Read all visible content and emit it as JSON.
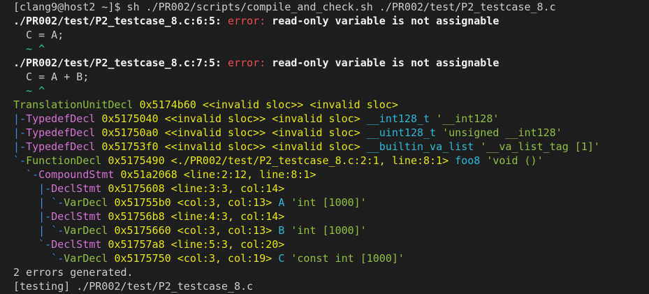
{
  "window": {
    "title": ""
  },
  "colors": {
    "background": "#1e1e1e",
    "default": "#cccccc",
    "bold_white": "#f2f2f2",
    "error_red": "#f14c4c",
    "caret_green": "#23d18b",
    "node_green": "#8ec03f",
    "addr_yellow": "#e5e510",
    "tree_blue": "#3b8eea",
    "node_magenta": "#d670d6",
    "ident_cyan": "#29b8db",
    "quote_green": "#8ec03f"
  },
  "terminal": {
    "lines": [
      {
        "segments": [
          {
            "text": "[clang9@host2 ~]$ sh ./PR002/scripts/compile_and_check.sh ./PR002/test/P2_testcase_8.c",
            "color": "#cccccc",
            "bold": false
          }
        ]
      },
      {
        "segments": [
          {
            "text": "./PR002/test/P2_testcase_8.c:6:5: ",
            "color": "#f2f2f2",
            "bold": true
          },
          {
            "text": "error: ",
            "color": "#f14c4c",
            "bold": false
          },
          {
            "text": "read-only variable is not assignable",
            "color": "#f2f2f2",
            "bold": true
          }
        ]
      },
      {
        "segments": [
          {
            "text": "  C = A;",
            "color": "#cccccc",
            "bold": false
          }
        ]
      },
      {
        "segments": [
          {
            "text": "  ~ ^",
            "color": "#23d18b",
            "bold": false
          }
        ]
      },
      {
        "segments": [
          {
            "text": "./PR002/test/P2_testcase_8.c:7:5: ",
            "color": "#f2f2f2",
            "bold": true
          },
          {
            "text": "error: ",
            "color": "#f14c4c",
            "bold": false
          },
          {
            "text": "read-only variable is not assignable",
            "color": "#f2f2f2",
            "bold": true
          }
        ]
      },
      {
        "segments": [
          {
            "text": "  C = A + B;",
            "color": "#cccccc",
            "bold": false
          }
        ]
      },
      {
        "segments": [
          {
            "text": "  ~ ^",
            "color": "#23d18b",
            "bold": false
          }
        ]
      },
      {
        "segments": [
          {
            "text": "TranslationUnitDecl ",
            "color": "#8ec03f",
            "bold": false
          },
          {
            "text": "0x5174b60",
            "color": "#e5e510",
            "bold": false
          },
          {
            "text": " <<invalid sloc>> ",
            "color": "#e5e510",
            "bold": false
          },
          {
            "text": "<invalid sloc>",
            "color": "#e5e510",
            "bold": false
          }
        ]
      },
      {
        "segments": [
          {
            "text": "|-",
            "color": "#3b8eea",
            "bold": false
          },
          {
            "text": "TypedefDecl ",
            "color": "#d670d6",
            "bold": false
          },
          {
            "text": "0x5175040",
            "color": "#e5e510",
            "bold": false
          },
          {
            "text": " <<invalid sloc>> ",
            "color": "#e5e510",
            "bold": false
          },
          {
            "text": "<invalid sloc>",
            "color": "#e5e510",
            "bold": false
          },
          {
            "text": " __int128_t ",
            "color": "#29b8db",
            "bold": false
          },
          {
            "text": "'__int128'",
            "color": "#8ec03f",
            "bold": false
          }
        ]
      },
      {
        "segments": [
          {
            "text": "|-",
            "color": "#3b8eea",
            "bold": false
          },
          {
            "text": "TypedefDecl ",
            "color": "#d670d6",
            "bold": false
          },
          {
            "text": "0x51750a0",
            "color": "#e5e510",
            "bold": false
          },
          {
            "text": " <<invalid sloc>> ",
            "color": "#e5e510",
            "bold": false
          },
          {
            "text": "<invalid sloc>",
            "color": "#e5e510",
            "bold": false
          },
          {
            "text": " __uint128_t ",
            "color": "#29b8db",
            "bold": false
          },
          {
            "text": "'unsigned __int128'",
            "color": "#8ec03f",
            "bold": false
          }
        ]
      },
      {
        "segments": [
          {
            "text": "|-",
            "color": "#3b8eea",
            "bold": false
          },
          {
            "text": "TypedefDecl ",
            "color": "#d670d6",
            "bold": false
          },
          {
            "text": "0x51753f0",
            "color": "#e5e510",
            "bold": false
          },
          {
            "text": " <<invalid sloc>> ",
            "color": "#e5e510",
            "bold": false
          },
          {
            "text": "<invalid sloc>",
            "color": "#e5e510",
            "bold": false
          },
          {
            "text": " __builtin_va_list ",
            "color": "#29b8db",
            "bold": false
          },
          {
            "text": "'__va_list_tag [1]'",
            "color": "#8ec03f",
            "bold": false
          }
        ]
      },
      {
        "segments": [
          {
            "text": "`-",
            "color": "#3b8eea",
            "bold": false
          },
          {
            "text": "FunctionDecl ",
            "color": "#8ec03f",
            "bold": false
          },
          {
            "text": "0x5175490",
            "color": "#e5e510",
            "bold": false
          },
          {
            "text": " <./PR002/test/P2_testcase_8.c:2:1, line:8:1> ",
            "color": "#e5e510",
            "bold": false
          },
          {
            "text": "foo8 ",
            "color": "#29b8db",
            "bold": false
          },
          {
            "text": "'void ()'",
            "color": "#8ec03f",
            "bold": false
          }
        ]
      },
      {
        "segments": [
          {
            "text": "  `-",
            "color": "#3b8eea",
            "bold": false
          },
          {
            "text": "CompoundStmt ",
            "color": "#d670d6",
            "bold": false
          },
          {
            "text": "0x51a2068",
            "color": "#e5e510",
            "bold": false
          },
          {
            "text": " <line:2:12, line:8:1>",
            "color": "#e5e510",
            "bold": false
          }
        ]
      },
      {
        "segments": [
          {
            "text": "    |-",
            "color": "#3b8eea",
            "bold": false
          },
          {
            "text": "DeclStmt ",
            "color": "#d670d6",
            "bold": false
          },
          {
            "text": "0x5175608",
            "color": "#e5e510",
            "bold": false
          },
          {
            "text": " <line:3:3, col:14>",
            "color": "#e5e510",
            "bold": false
          }
        ]
      },
      {
        "segments": [
          {
            "text": "    | `-",
            "color": "#3b8eea",
            "bold": false
          },
          {
            "text": "VarDecl ",
            "color": "#8ec03f",
            "bold": false
          },
          {
            "text": "0x51755b0",
            "color": "#e5e510",
            "bold": false
          },
          {
            "text": " <col:3, col:13> ",
            "color": "#e5e510",
            "bold": false
          },
          {
            "text": "A ",
            "color": "#29b8db",
            "bold": false
          },
          {
            "text": "'int [1000]'",
            "color": "#8ec03f",
            "bold": false
          }
        ]
      },
      {
        "segments": [
          {
            "text": "    |-",
            "color": "#3b8eea",
            "bold": false
          },
          {
            "text": "DeclStmt ",
            "color": "#d670d6",
            "bold": false
          },
          {
            "text": "0x51756b8",
            "color": "#e5e510",
            "bold": false
          },
          {
            "text": " <line:4:3, col:14>",
            "color": "#e5e510",
            "bold": false
          }
        ]
      },
      {
        "segments": [
          {
            "text": "    | `-",
            "color": "#3b8eea",
            "bold": false
          },
          {
            "text": "VarDecl ",
            "color": "#8ec03f",
            "bold": false
          },
          {
            "text": "0x5175660",
            "color": "#e5e510",
            "bold": false
          },
          {
            "text": " <col:3, col:13> ",
            "color": "#e5e510",
            "bold": false
          },
          {
            "text": "B ",
            "color": "#29b8db",
            "bold": false
          },
          {
            "text": "'int [1000]'",
            "color": "#8ec03f",
            "bold": false
          }
        ]
      },
      {
        "segments": [
          {
            "text": "    `-",
            "color": "#3b8eea",
            "bold": false
          },
          {
            "text": "DeclStmt ",
            "color": "#d670d6",
            "bold": false
          },
          {
            "text": "0x51757a8",
            "color": "#e5e510",
            "bold": false
          },
          {
            "text": " <line:5:3, col:20>",
            "color": "#e5e510",
            "bold": false
          }
        ]
      },
      {
        "segments": [
          {
            "text": "      `-",
            "color": "#3b8eea",
            "bold": false
          },
          {
            "text": "VarDecl ",
            "color": "#8ec03f",
            "bold": false
          },
          {
            "text": "0x5175750",
            "color": "#e5e510",
            "bold": false
          },
          {
            "text": " <col:3, col:19> ",
            "color": "#e5e510",
            "bold": false
          },
          {
            "text": "C ",
            "color": "#29b8db",
            "bold": false
          },
          {
            "text": "'const int [1000]'",
            "color": "#8ec03f",
            "bold": false
          }
        ]
      },
      {
        "segments": [
          {
            "text": "2 errors generated.",
            "color": "#cccccc",
            "bold": false
          }
        ]
      },
      {
        "segments": [
          {
            "text": "[testing] ./PR002/test/P2_testcase_8.c",
            "color": "#cccccc",
            "bold": false
          }
        ]
      }
    ]
  }
}
